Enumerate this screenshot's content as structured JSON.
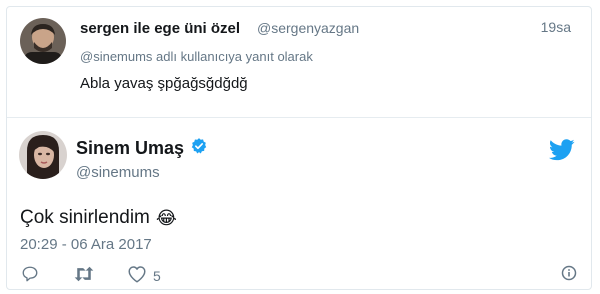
{
  "reply": {
    "name": "sergen ile ege üni özel",
    "handle": "@sergenyazgan",
    "time": "19sa",
    "context": "@sinemums adlı kullanıcıya yanıt olarak",
    "text": "Abla yavaş şpğağsğdğdğ"
  },
  "tweet": {
    "name": "Sinem Umaş",
    "handle": "@sinemums",
    "text": "Çok sinirlendim",
    "emoji": "😂",
    "date": "20:29 - 06 Ara 2017",
    "like_count": "5"
  },
  "colors": {
    "accent": "#1da1f2",
    "muted": "#657786",
    "text": "#14171a"
  },
  "icons": [
    "verified-badge-icon",
    "twitter-bird-icon",
    "reply-icon",
    "retweet-icon",
    "like-icon",
    "info-icon"
  ]
}
